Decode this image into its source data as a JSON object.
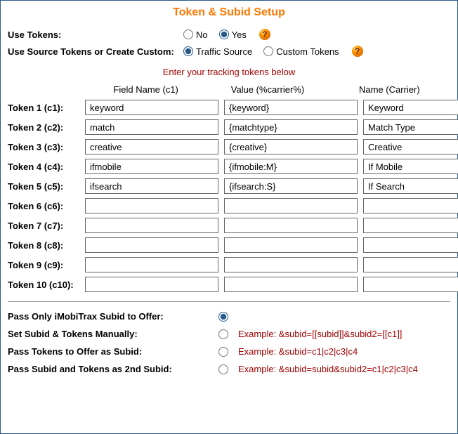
{
  "title": "Token & Subid Setup",
  "useTokens": {
    "label": "Use Tokens:",
    "no": "No",
    "yes": "Yes",
    "selected": "yes"
  },
  "sourceOrCustom": {
    "label": "Use Source Tokens or Create Custom:",
    "traffic": "Traffic Source",
    "custom": "Custom Tokens",
    "selected": "traffic"
  },
  "trackingNote": "Enter your tracking tokens below",
  "columns": {
    "field": "Field Name (c1)",
    "value": "Value (%carrier%)",
    "name": "Name (Carrier)"
  },
  "tokens": [
    {
      "label": "Token 1 (c1):",
      "field": "keyword",
      "value": "{keyword}",
      "name": "Keyword"
    },
    {
      "label": "Token 2 (c2):",
      "field": "match",
      "value": "{matchtype}",
      "name": "Match Type"
    },
    {
      "label": "Token 3 (c3):",
      "field": "creative",
      "value": "{creative}",
      "name": "Creative"
    },
    {
      "label": "Token 4 (c4):",
      "field": "ifmobile",
      "value": "{ifmobile:M}",
      "name": "If Mobile"
    },
    {
      "label": "Token 5 (c5):",
      "field": "ifsearch",
      "value": "{ifsearch:S}",
      "name": "If Search"
    },
    {
      "label": "Token 6 (c6):",
      "field": "",
      "value": "",
      "name": ""
    },
    {
      "label": "Token 7 (c7):",
      "field": "",
      "value": "",
      "name": ""
    },
    {
      "label": "Token 8 (c8):",
      "field": "",
      "value": "",
      "name": ""
    },
    {
      "label": "Token 9 (c9):",
      "field": "",
      "value": "",
      "name": ""
    },
    {
      "label": "Token 10 (c10):",
      "field": "",
      "value": "",
      "name": ""
    }
  ],
  "sub": {
    "passOnly": {
      "label": "Pass Only iMobiTrax Subid to Offer:",
      "example": "",
      "checked": true
    },
    "manual": {
      "label": "Set Subid & Tokens Manually:",
      "example": "Example: &subid=[[subid]]&subid2=[[c1]]",
      "checked": false
    },
    "asSubid": {
      "label": "Pass Tokens to Offer as Subid:",
      "example": "Example: &subid=c1|c2|c3|c4",
      "checked": false
    },
    "as2ndSubid": {
      "label": "Pass Subid and Tokens as 2nd Subid:",
      "example": "Example: &subid=subid&subid2=c1|c2|c3|c4",
      "checked": false
    }
  },
  "helpGlyph": "?"
}
